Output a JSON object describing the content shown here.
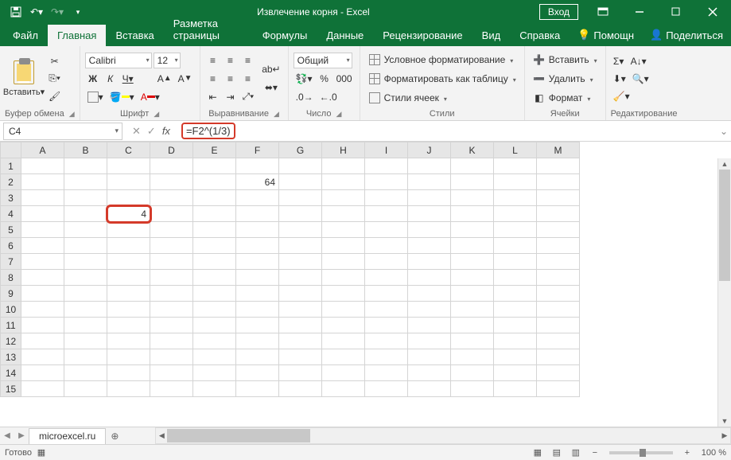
{
  "titlebar": {
    "title": "Извлечение корня  -  Excel",
    "login": "Вход"
  },
  "tabs": {
    "file": "Файл",
    "home": "Главная",
    "insert": "Вставка",
    "layout": "Разметка страницы",
    "formulas": "Формулы",
    "data": "Данные",
    "review": "Рецензирование",
    "view": "Вид",
    "help": "Справка",
    "tellme": "Помощн",
    "share": "Поделиться"
  },
  "ribbon": {
    "clipboard": {
      "label": "Буфер обмена",
      "paste": "Вставить"
    },
    "font": {
      "label": "Шрифт",
      "name": "Calibri",
      "size": "12",
      "bold": "Ж",
      "italic": "К",
      "underline": "Ч"
    },
    "alignment": {
      "label": "Выравнивание",
      "wrap": "ab"
    },
    "number": {
      "label": "Число",
      "format": "Общий",
      "percent": "%",
      "comma": "000"
    },
    "styles": {
      "label": "Стили",
      "cond": "Условное форматирование",
      "table": "Форматировать как таблицу",
      "cell": "Стили ячеек"
    },
    "cells": {
      "label": "Ячейки",
      "insert": "Вставить",
      "delete": "Удалить",
      "format": "Формат"
    },
    "editing": {
      "label": "Редактирование"
    }
  },
  "fbar": {
    "namebox": "C4",
    "fx": "fx",
    "formula": "=F2^(1/3)"
  },
  "grid": {
    "columns": [
      "A",
      "B",
      "C",
      "D",
      "E",
      "F",
      "G",
      "H",
      "I",
      "J",
      "K",
      "L",
      "M"
    ],
    "rows": 15,
    "active": {
      "row": 4,
      "col": "C",
      "value": "4"
    },
    "f2": "64"
  },
  "sheet": {
    "name": "microexcel.ru"
  },
  "status": {
    "ready": "Готово",
    "zoom": "100 %"
  }
}
